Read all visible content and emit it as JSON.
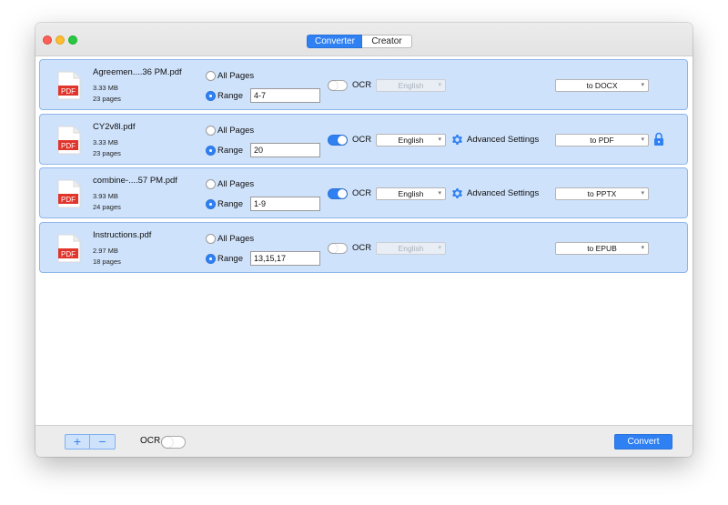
{
  "tabs": {
    "converter": "Converter",
    "creator": "Creator"
  },
  "labels": {
    "all_pages": "All Pages",
    "range": "Range",
    "ocr": "OCR",
    "advanced_settings": "Advanced Settings",
    "pdf_icon_text": "PDF"
  },
  "files": [
    {
      "name": "Agreemen....36 PM.pdf",
      "size": "3.33 MB",
      "pages": "23 pages",
      "range": "4-7",
      "ocr_on": false,
      "language": "English",
      "output": "to DOCX",
      "locked": false
    },
    {
      "name": "CY2v8l.pdf",
      "size": "3.33 MB",
      "pages": "23 pages",
      "range": "20",
      "ocr_on": true,
      "language": "English",
      "output": "to PDF",
      "locked": true
    },
    {
      "name": "combine-....57 PM.pdf",
      "size": "3.93 MB",
      "pages": "24 pages",
      "range": "1-9",
      "ocr_on": true,
      "language": "English",
      "output": "to PPTX",
      "locked": false
    },
    {
      "name": "Instructions.pdf",
      "size": "2.97 MB",
      "pages": "18 pages",
      "range": "13,15,17",
      "ocr_on": false,
      "language": "English",
      "output": "to EPUB",
      "locked": false
    }
  ],
  "bottom": {
    "add": "+",
    "remove": "−",
    "ocr": "OCR",
    "convert": "Convert"
  },
  "colors": {
    "accent": "#2f80f3",
    "row_bg": "#cfe2fb",
    "row_border": "#8fb6ea",
    "pdf_red": "#e0352b"
  },
  "icons": {
    "pdf": "pdf-file-icon",
    "gear": "gear-icon",
    "lock": "lock-icon"
  }
}
